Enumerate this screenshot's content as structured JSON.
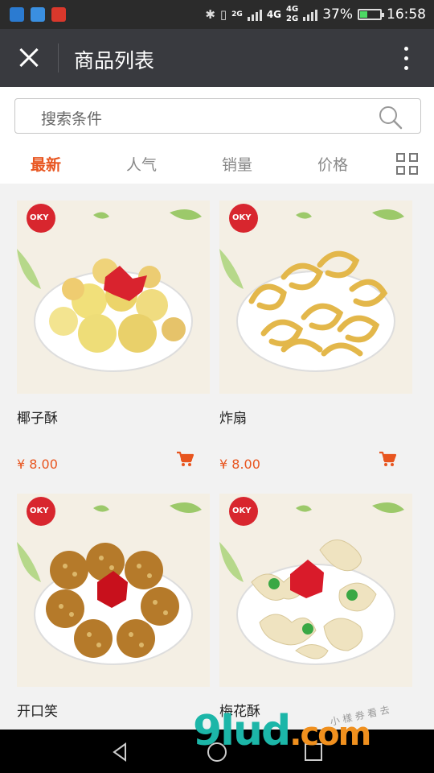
{
  "status_bar": {
    "network_1": "4G",
    "network_2": "4G",
    "network_2_sub": "2G",
    "network_1_sub": "2G",
    "battery": "37%",
    "battery_level": 0.37,
    "time": "16:58",
    "icons": [
      "usb-icon",
      "gallery-icon",
      "huawei-icon",
      "bluetooth-icon",
      "vibrate-icon"
    ]
  },
  "header": {
    "title": "商品列表",
    "close_icon": "close-icon",
    "more_icon": "more-vertical-icon"
  },
  "search": {
    "placeholder": "搜索条件",
    "icon": "search-icon"
  },
  "tabs": [
    {
      "label": "最新",
      "active": true
    },
    {
      "label": "人气",
      "active": false
    },
    {
      "label": "销量",
      "active": false
    },
    {
      "label": "价格",
      "active": false
    }
  ],
  "view_toggle_icon": "grid-view-icon",
  "products": [
    {
      "name": "椰子酥",
      "price": "¥ 8.00",
      "badge": "OKY"
    },
    {
      "name": "炸扇",
      "price": "¥ 8.00",
      "badge": "OKY"
    },
    {
      "name": "开口笑",
      "price": "",
      "badge": "OKY"
    },
    {
      "name": "梅花酥",
      "price": "",
      "badge": "OKY"
    }
  ],
  "nav_bar": {
    "icons": [
      "back-icon",
      "home-icon",
      "recents-icon"
    ]
  },
  "watermark": {
    "main": "9lud",
    "tld": ".com",
    "sub": "小 樣 券 看 去"
  },
  "colors": {
    "accent": "#e8551f",
    "title_bar": "#393a3f",
    "status_bar": "#2b2b2b"
  }
}
